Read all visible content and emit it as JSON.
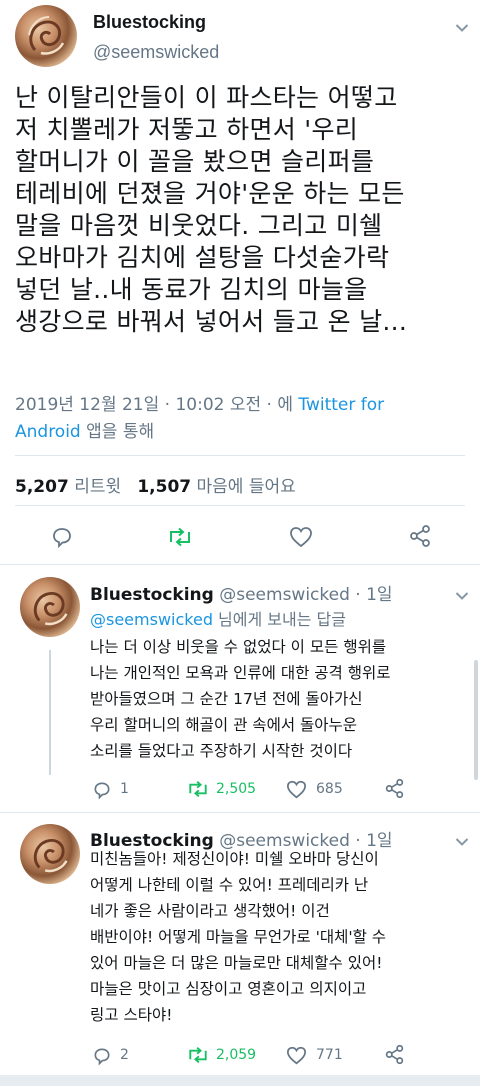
{
  "main_tweet": {
    "author_name": "Bluestocking",
    "author_handle": "@seemswicked",
    "lines": [
      "난 이탈리안들이 이 파스타는 어떻고",
      "저 치뽈레가 저뚷고 하면서 '우리",
      "할머니가 이 꼴을 봤으면 슬리퍼를",
      "테레비에 던졌을 거야'운운 하는 모든",
      "말을 마음껏 비웃었다. 그리고 미쉘",
      "오바마가 김치에 설탕을 다섯숟가락",
      "넣던 날..내 동료가 김치의 마늘을",
      "생강으로 바꿔서 넣어서 들고 온 날..."
    ],
    "timestamp": "2019년 12월 21일 · 10:02 오전 · 에 ",
    "via_link": "Twitter for",
    "via_link2": "Android",
    "via_suffix": " 앱을 통해",
    "retweets_count": "5,207",
    "retweets_label": "리트윗",
    "likes_count": "1,507",
    "likes_label": "마음에 들어요",
    "actions": [
      "reply-icon",
      "retweet-icon",
      "like-icon",
      "share-icon"
    ]
  },
  "replies": [
    {
      "author_name": "Bluestocking",
      "author_handle": "@seemswicked",
      "age": "· 1일",
      "replying_to_handle": "@seemswicked",
      "replying_to_suffix": " 님에게 보내는 답글",
      "lines": [
        "나는 더 이상 비웃을 수 없었다 이 모든 행위를",
        "나는 개인적인 모욕과 인류에 대한 공격 행위로",
        "받아들였으며 그 순간 17년 전에 돌아가신",
        "우리 할머니의 해골이 관 속에서 돌아누운",
        "소리를 들었다고 주장하기 시작한 것이다"
      ],
      "reply_count": "1",
      "retweet_count": "2,505",
      "like_count": "685"
    },
    {
      "author_name": "Bluestocking",
      "author_handle": "@seemswicked",
      "age": "· 1일",
      "lines": [
        "미친놈들아! 제정신이야! 미쉘 오바마 당신이",
        "어떻게 나한테 이럴 수 있어! 프레데리카 난",
        "네가 좋은 사람이라고 생각했어! 이건",
        "배반이야! 어떻게 마늘을 무언가로 '대체'할 수",
        "있어 마늘은 더 많은 마늘로만 대체할수 있어!",
        "마늘은 맛이고 심장이고 영혼이고 의지이고",
        "링고 스타야!"
      ],
      "reply_count": "2",
      "retweet_count": "2,059",
      "like_count": "771"
    }
  ],
  "colors": {
    "accent": "#1b95e0",
    "retweet_green": "#17bf63",
    "secondary_text": "#657786",
    "divider": "#e1e8ed"
  }
}
